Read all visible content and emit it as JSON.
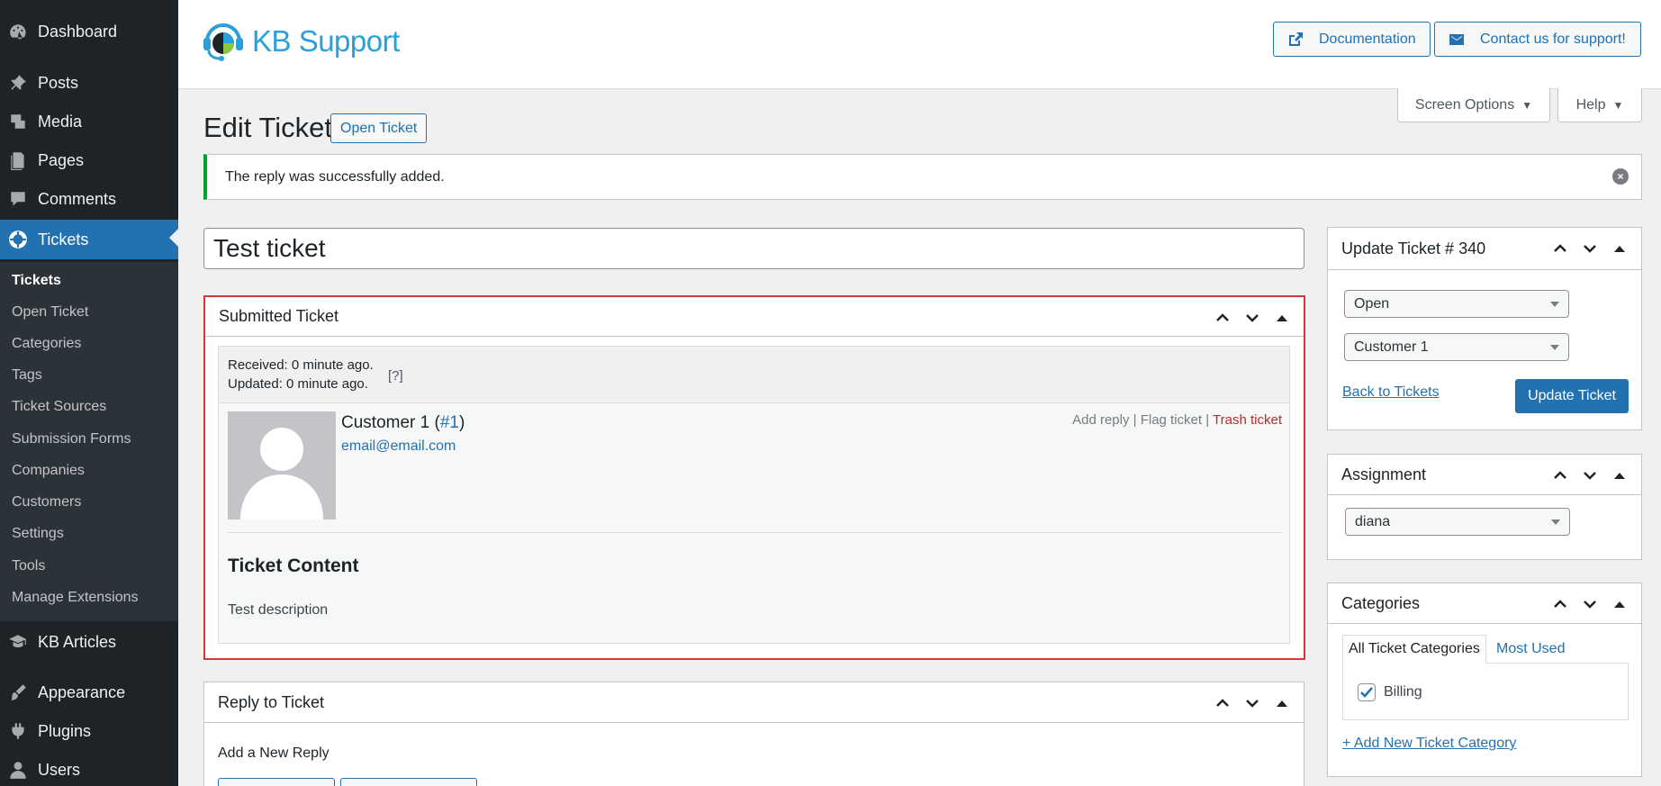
{
  "sidebar": {
    "items": [
      {
        "label": "Dashboard",
        "icon": "dashboard-icon"
      },
      {
        "label": "Posts",
        "icon": "pin-icon"
      },
      {
        "label": "Media",
        "icon": "media-icon"
      },
      {
        "label": "Pages",
        "icon": "pages-icon"
      },
      {
        "label": "Comments",
        "icon": "comments-icon"
      },
      {
        "label": "Tickets",
        "icon": "tickets-icon"
      },
      {
        "label": "KB Articles",
        "icon": "kb-articles-icon"
      },
      {
        "label": "Appearance",
        "icon": "appearance-icon"
      },
      {
        "label": "Plugins",
        "icon": "plugins-icon"
      },
      {
        "label": "Users",
        "icon": "users-icon"
      }
    ],
    "submenu": [
      "Tickets",
      "Open Ticket",
      "Categories",
      "Tags",
      "Ticket Sources",
      "Submission Forms",
      "Companies",
      "Customers",
      "Settings",
      "Tools",
      "Manage Extensions"
    ]
  },
  "header": {
    "brand": "KB Support",
    "documentation": "Documentation",
    "contact": "Contact us for support!"
  },
  "screen_options": {
    "label": "Screen Options",
    "help": "Help"
  },
  "page": {
    "title": "Edit Ticket",
    "open_ticket": "Open Ticket",
    "notice": "The reply was successfully added.",
    "ticket_title": "Test ticket"
  },
  "submitted": {
    "heading": "Submitted Ticket",
    "received": "Received: 0 minute ago.",
    "updated": "Updated: 0 minute ago.",
    "help_link": "[?]",
    "customer_name": "Customer 1",
    "customer_id_prefix": " (",
    "customer_id": "#1",
    "customer_id_suffix": ")",
    "email": "email@email.com",
    "add_reply": "Add reply",
    "flag_ticket": "Flag ticket",
    "trash_ticket": "Trash ticket",
    "separator": " | ",
    "content_heading": "Ticket Content",
    "content": "Test description"
  },
  "reply": {
    "heading": "Reply to Ticket",
    "subheading": "Add a New Reply"
  },
  "update_box": {
    "heading": "Update Ticket # 340",
    "status": "Open",
    "customer": "Customer 1",
    "back": "Back to Tickets",
    "update": "Update Ticket"
  },
  "assignment": {
    "heading": "Assignment",
    "agent": "diana"
  },
  "categories": {
    "heading": "Categories",
    "tab_all": "All Ticket Categories",
    "tab_used": "Most Used",
    "items": [
      {
        "label": "Billing",
        "checked": true
      }
    ],
    "add_new": "+ Add New Ticket Category"
  },
  "colors": {
    "accent": "#2271b1",
    "sidebar": "#1d2327",
    "success": "#00a32a",
    "highlight": "#d63638",
    "danger": "#b32d2e"
  }
}
